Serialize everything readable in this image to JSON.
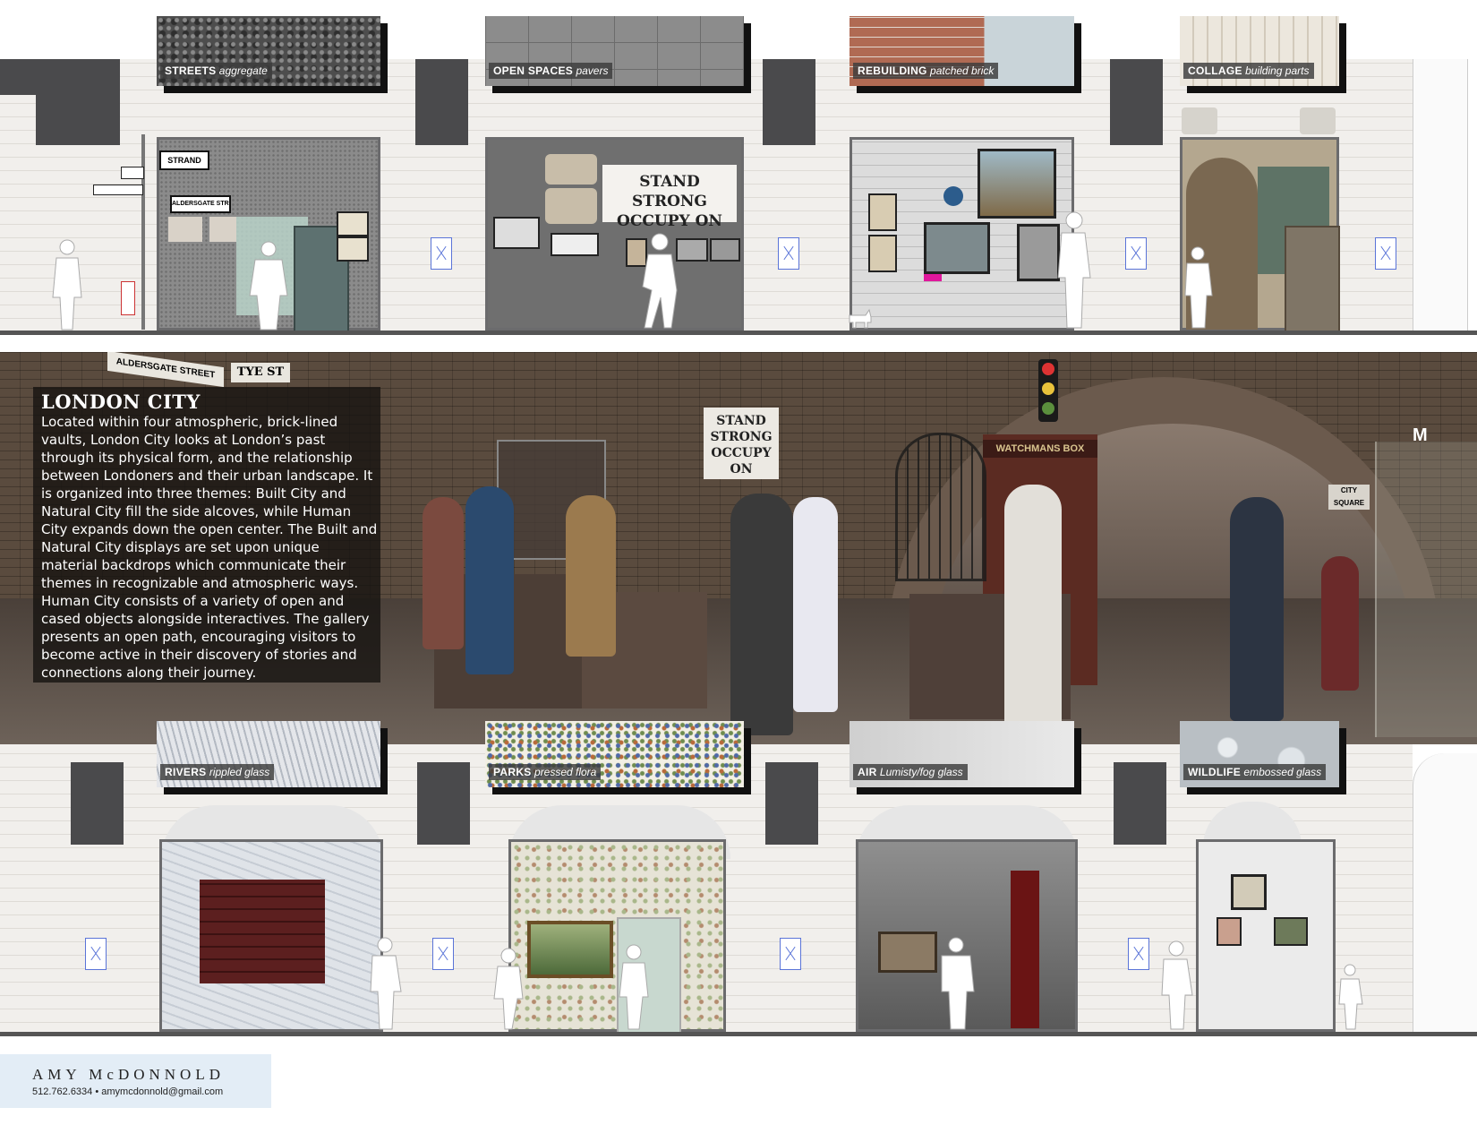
{
  "top_materials": [
    {
      "name": "STREETS",
      "material": "aggregate"
    },
    {
      "name": "OPEN SPACES",
      "material": "pavers"
    },
    {
      "name": "REBUILDING",
      "material": "patched brick"
    },
    {
      "name": "COLLAGE",
      "material": "building parts"
    }
  ],
  "bottom_materials": [
    {
      "name": "RIVERS",
      "material": "rippled glass"
    },
    {
      "name": "PARKS",
      "material": "pressed flora"
    },
    {
      "name": "AIR",
      "material": "Lumisty/fog glass"
    },
    {
      "name": "WILDLIFE",
      "material": "embossed glass"
    }
  ],
  "gallery": {
    "title": "LONDON CITY",
    "description": "Located within four atmospheric, brick-lined vaults, London City looks at London’s past through its physical form, and the relationship between Londoners and their urban landscape. It is organized into three themes: Built City and Natural City fill the side alcoves, while Human City expands down the open center. The Built and Natural City displays are set upon unique material backdrops which communicate their themes in recognizable and atmospheric ways. Human City consists of a variety of open and cased objects alongside interactives. The gallery presents an open path, encouraging visitors to become active in their discovery of stories and connections along their journey."
  },
  "render_signs": {
    "sign_1": "ALDERSGATE STREET",
    "sign_2": "TYE ST",
    "banner": "STAND STRONG OCCUPY ON",
    "booth": "WATCHMANS BOX",
    "logo": "M",
    "side_sign": "CITY SQUARE"
  },
  "elevation_signs": {
    "strand": "STRAND",
    "aldersgate": "ALDERSGATE STREET",
    "banner": "STAND STRONG OCCUPY ON"
  },
  "author": {
    "name": "AMY McDONNOLD",
    "contact": "512.762.6334 • amymcdonnold@gmail.com"
  },
  "colors": {
    "wall": "#f1efec",
    "pillar": "#4a4a4c",
    "text_panel": "#141210",
    "name_card": "#e3edf6",
    "tag_outline": "#5a74d8"
  }
}
